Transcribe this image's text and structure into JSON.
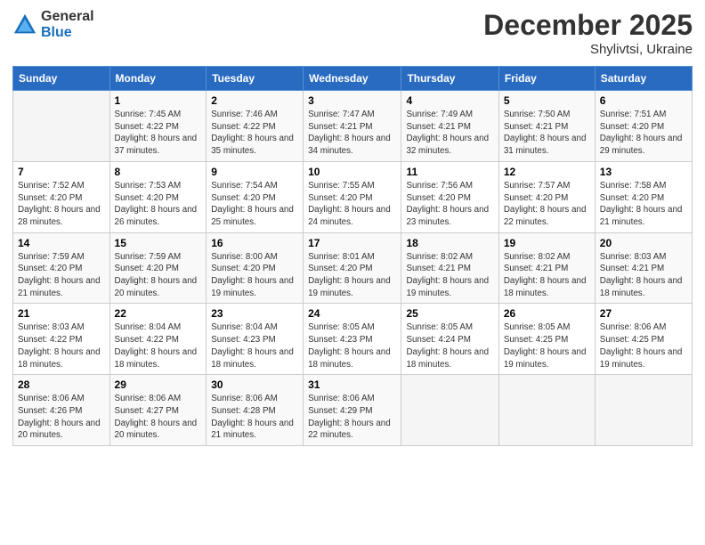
{
  "header": {
    "logo_general": "General",
    "logo_blue": "Blue",
    "month_title": "December 2025",
    "location": "Shylivtsi, Ukraine"
  },
  "weekdays": [
    "Sunday",
    "Monday",
    "Tuesday",
    "Wednesday",
    "Thursday",
    "Friday",
    "Saturday"
  ],
  "weeks": [
    [
      {
        "day": "",
        "sunrise": "",
        "sunset": "",
        "daylight": ""
      },
      {
        "day": "1",
        "sunrise": "Sunrise: 7:45 AM",
        "sunset": "Sunset: 4:22 PM",
        "daylight": "Daylight: 8 hours and 37 minutes."
      },
      {
        "day": "2",
        "sunrise": "Sunrise: 7:46 AM",
        "sunset": "Sunset: 4:22 PM",
        "daylight": "Daylight: 8 hours and 35 minutes."
      },
      {
        "day": "3",
        "sunrise": "Sunrise: 7:47 AM",
        "sunset": "Sunset: 4:21 PM",
        "daylight": "Daylight: 8 hours and 34 minutes."
      },
      {
        "day": "4",
        "sunrise": "Sunrise: 7:49 AM",
        "sunset": "Sunset: 4:21 PM",
        "daylight": "Daylight: 8 hours and 32 minutes."
      },
      {
        "day": "5",
        "sunrise": "Sunrise: 7:50 AM",
        "sunset": "Sunset: 4:21 PM",
        "daylight": "Daylight: 8 hours and 31 minutes."
      },
      {
        "day": "6",
        "sunrise": "Sunrise: 7:51 AM",
        "sunset": "Sunset: 4:20 PM",
        "daylight": "Daylight: 8 hours and 29 minutes."
      }
    ],
    [
      {
        "day": "7",
        "sunrise": "Sunrise: 7:52 AM",
        "sunset": "Sunset: 4:20 PM",
        "daylight": "Daylight: 8 hours and 28 minutes."
      },
      {
        "day": "8",
        "sunrise": "Sunrise: 7:53 AM",
        "sunset": "Sunset: 4:20 PM",
        "daylight": "Daylight: 8 hours and 26 minutes."
      },
      {
        "day": "9",
        "sunrise": "Sunrise: 7:54 AM",
        "sunset": "Sunset: 4:20 PM",
        "daylight": "Daylight: 8 hours and 25 minutes."
      },
      {
        "day": "10",
        "sunrise": "Sunrise: 7:55 AM",
        "sunset": "Sunset: 4:20 PM",
        "daylight": "Daylight: 8 hours and 24 minutes."
      },
      {
        "day": "11",
        "sunrise": "Sunrise: 7:56 AM",
        "sunset": "Sunset: 4:20 PM",
        "daylight": "Daylight: 8 hours and 23 minutes."
      },
      {
        "day": "12",
        "sunrise": "Sunrise: 7:57 AM",
        "sunset": "Sunset: 4:20 PM",
        "daylight": "Daylight: 8 hours and 22 minutes."
      },
      {
        "day": "13",
        "sunrise": "Sunrise: 7:58 AM",
        "sunset": "Sunset: 4:20 PM",
        "daylight": "Daylight: 8 hours and 21 minutes."
      }
    ],
    [
      {
        "day": "14",
        "sunrise": "Sunrise: 7:59 AM",
        "sunset": "Sunset: 4:20 PM",
        "daylight": "Daylight: 8 hours and 21 minutes."
      },
      {
        "day": "15",
        "sunrise": "Sunrise: 7:59 AM",
        "sunset": "Sunset: 4:20 PM",
        "daylight": "Daylight: 8 hours and 20 minutes."
      },
      {
        "day": "16",
        "sunrise": "Sunrise: 8:00 AM",
        "sunset": "Sunset: 4:20 PM",
        "daylight": "Daylight: 8 hours and 19 minutes."
      },
      {
        "day": "17",
        "sunrise": "Sunrise: 8:01 AM",
        "sunset": "Sunset: 4:20 PM",
        "daylight": "Daylight: 8 hours and 19 minutes."
      },
      {
        "day": "18",
        "sunrise": "Sunrise: 8:02 AM",
        "sunset": "Sunset: 4:21 PM",
        "daylight": "Daylight: 8 hours and 19 minutes."
      },
      {
        "day": "19",
        "sunrise": "Sunrise: 8:02 AM",
        "sunset": "Sunset: 4:21 PM",
        "daylight": "Daylight: 8 hours and 18 minutes."
      },
      {
        "day": "20",
        "sunrise": "Sunrise: 8:03 AM",
        "sunset": "Sunset: 4:21 PM",
        "daylight": "Daylight: 8 hours and 18 minutes."
      }
    ],
    [
      {
        "day": "21",
        "sunrise": "Sunrise: 8:03 AM",
        "sunset": "Sunset: 4:22 PM",
        "daylight": "Daylight: 8 hours and 18 minutes."
      },
      {
        "day": "22",
        "sunrise": "Sunrise: 8:04 AM",
        "sunset": "Sunset: 4:22 PM",
        "daylight": "Daylight: 8 hours and 18 minutes."
      },
      {
        "day": "23",
        "sunrise": "Sunrise: 8:04 AM",
        "sunset": "Sunset: 4:23 PM",
        "daylight": "Daylight: 8 hours and 18 minutes."
      },
      {
        "day": "24",
        "sunrise": "Sunrise: 8:05 AM",
        "sunset": "Sunset: 4:23 PM",
        "daylight": "Daylight: 8 hours and 18 minutes."
      },
      {
        "day": "25",
        "sunrise": "Sunrise: 8:05 AM",
        "sunset": "Sunset: 4:24 PM",
        "daylight": "Daylight: 8 hours and 18 minutes."
      },
      {
        "day": "26",
        "sunrise": "Sunrise: 8:05 AM",
        "sunset": "Sunset: 4:25 PM",
        "daylight": "Daylight: 8 hours and 19 minutes."
      },
      {
        "day": "27",
        "sunrise": "Sunrise: 8:06 AM",
        "sunset": "Sunset: 4:25 PM",
        "daylight": "Daylight: 8 hours and 19 minutes."
      }
    ],
    [
      {
        "day": "28",
        "sunrise": "Sunrise: 8:06 AM",
        "sunset": "Sunset: 4:26 PM",
        "daylight": "Daylight: 8 hours and 20 minutes."
      },
      {
        "day": "29",
        "sunrise": "Sunrise: 8:06 AM",
        "sunset": "Sunset: 4:27 PM",
        "daylight": "Daylight: 8 hours and 20 minutes."
      },
      {
        "day": "30",
        "sunrise": "Sunrise: 8:06 AM",
        "sunset": "Sunset: 4:28 PM",
        "daylight": "Daylight: 8 hours and 21 minutes."
      },
      {
        "day": "31",
        "sunrise": "Sunrise: 8:06 AM",
        "sunset": "Sunset: 4:29 PM",
        "daylight": "Daylight: 8 hours and 22 minutes."
      },
      {
        "day": "",
        "sunrise": "",
        "sunset": "",
        "daylight": ""
      },
      {
        "day": "",
        "sunrise": "",
        "sunset": "",
        "daylight": ""
      },
      {
        "day": "",
        "sunrise": "",
        "sunset": "",
        "daylight": ""
      }
    ]
  ]
}
